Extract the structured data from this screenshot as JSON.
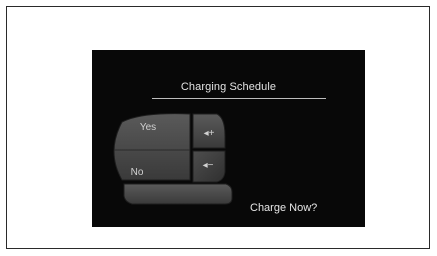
{
  "screen": {
    "title": "Charging Schedule",
    "prompt": "Charge Now?"
  },
  "controls": {
    "yes_label": "Yes",
    "no_label": "No",
    "volume_up_label": "◂+",
    "volume_down_label": "◂−"
  },
  "colors": {
    "screen_bg": "#080808",
    "button_face": "#474747",
    "button_dark": "#2c2c2c",
    "text": "#e3e3e3"
  }
}
